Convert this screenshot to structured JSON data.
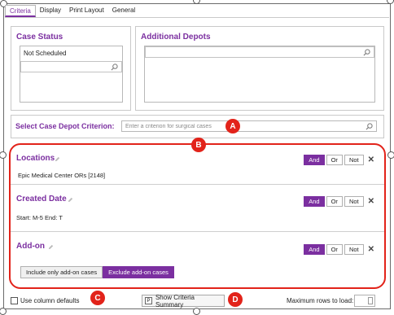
{
  "tabs": [
    {
      "label": "Criteria",
      "active": true
    },
    {
      "label": "Display",
      "active": false
    },
    {
      "label": "Print Layout",
      "active": false
    },
    {
      "label": "General",
      "active": false
    }
  ],
  "case_status": {
    "title": "Case Status",
    "selected_value": "Not Scheduled",
    "search_placeholder": ""
  },
  "additional_depots": {
    "title": "Additional Depots",
    "search_placeholder": ""
  },
  "criterion_search": {
    "label": "Select Case Depot Criterion:",
    "placeholder": "Enter a criterion for surgical cases"
  },
  "criteria": [
    {
      "title": "Locations",
      "value": "Epic Medical Center ORs [2148]"
    },
    {
      "title": "Created Date",
      "value": "Start: M-5 End: T"
    },
    {
      "title": "Add-on",
      "value": ""
    }
  ],
  "logic_buttons": {
    "and": "And",
    "or": "Or",
    "not": "Not"
  },
  "addon_options": {
    "include": "Include only add-on cases",
    "exclude": "Exclude add-on cases",
    "selected": "exclude"
  },
  "footer": {
    "use_defaults_label": "Use column defaults",
    "use_defaults_checked": false,
    "summary_button": "Show Criteria Summary",
    "max_rows_label": "Maximum rows to load:",
    "max_rows_value": ""
  },
  "callouts": {
    "a": "A",
    "b": "B",
    "c": "C",
    "d": "D"
  },
  "colors": {
    "accent": "#7b2fa0",
    "callout": "#e2231a"
  },
  "icons": [
    "magnifier-icon",
    "pencil-icon",
    "remove-icon",
    "summary-icon"
  ]
}
